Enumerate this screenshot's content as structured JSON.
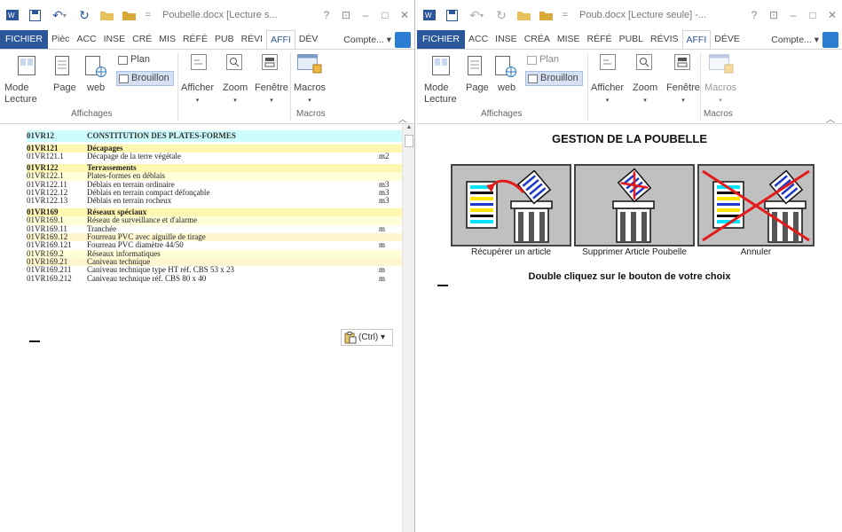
{
  "left_window": {
    "title": "Poubelle.docx [Lecture s...",
    "help": "?",
    "tabs": [
      "FICHIER",
      "Pièc",
      "ACC",
      "INSE",
      "CRÉ",
      "MIS",
      "RÉFÉ",
      "PUB",
      "RÉVI",
      "AFFI",
      "DÉV"
    ],
    "active_tab": "AFFI",
    "account": "Compte... ▾",
    "ribbon": {
      "mode_lecture": "Mode\nLecture",
      "mode_lecture_1": "Mode",
      "mode_lecture_2": "Lecture",
      "page": "Page",
      "web": "web",
      "plan": "Plan",
      "brouillon": "Brouillon",
      "afficher": "Afficher",
      "zoom": "Zoom",
      "fenetre": "Fenêtre",
      "macros": "Macros",
      "group_affichages": "Affichages",
      "group_macros": "Macros"
    },
    "document": {
      "rows": [
        {
          "style": "hdr",
          "code": "01VR12",
          "desc": "CONSTITUTION DES PLATES-FORMES",
          "unit": ""
        },
        {
          "style": "gap"
        },
        {
          "style": "hy",
          "code": "01VR121",
          "desc": "Décapages",
          "unit": ""
        },
        {
          "style": "",
          "code": "01VR121.1",
          "desc": "Décapage de la terre végétale",
          "unit": "m2"
        },
        {
          "style": "gap"
        },
        {
          "style": "hy",
          "code": "01VR122",
          "desc": "Terrassements",
          "unit": ""
        },
        {
          "style": "ly",
          "code": "01VR122.1",
          "desc": "Plates-formes en déblais",
          "unit": ""
        },
        {
          "style": "",
          "code": "01VR122.11",
          "desc": "Déblais en terrain ordinaire",
          "unit": "m3"
        },
        {
          "style": "",
          "code": "01VR122.12",
          "desc": "Déblais en terrain compact défonçable",
          "unit": "m3"
        },
        {
          "style": "",
          "code": "01VR122.13",
          "desc": "Déblais en terrain rocheux",
          "unit": "m3"
        },
        {
          "style": "gap"
        },
        {
          "style": "hy",
          "code": "01VR169",
          "desc": "Réseaux spéciaux",
          "unit": ""
        },
        {
          "style": "ly",
          "code": "01VR169.1",
          "desc": "Réseau de surveillance et d'alarme",
          "unit": ""
        },
        {
          "style": "",
          "code": "01VR169.11",
          "desc": "Tranchée",
          "unit": "m"
        },
        {
          "style": "ly2",
          "code": "01VR169.12",
          "desc": "Fourreau PVC avec aiguille de tirage",
          "unit": ""
        },
        {
          "style": "",
          "code": "01VR169.121",
          "desc": "Fourreau PVC diamètre 44/50",
          "unit": "m"
        },
        {
          "style": "ly",
          "code": "01VR169.2",
          "desc": "Réseaux informatiques",
          "unit": ""
        },
        {
          "style": "ly2",
          "code": "01VR169.21",
          "desc": "Caniveau technique",
          "unit": ""
        },
        {
          "style": "",
          "code": "01VR169.211",
          "desc": "Caniveau technique type HT réf. CBS 53 x 23",
          "unit": "m"
        },
        {
          "style": "",
          "code": "01VR169.212",
          "desc": "Caniveau technique réf. CBS 80 x 40",
          "unit": "m"
        }
      ],
      "paste_options": "(Ctrl) ▾"
    }
  },
  "right_window": {
    "title": "Poub.docx [Lecture seule] -...",
    "help": "?",
    "tabs": [
      "FICHIER",
      "ACC",
      "INSE",
      "CRÉA",
      "MISE",
      "RÉFÉ",
      "PUBL",
      "RÉVIS",
      "AFFI",
      "DÉVE"
    ],
    "active_tab": "AFFI",
    "account": "Compte... ▾",
    "ribbon": {
      "mode_lecture_1": "Mode",
      "mode_lecture_2": "Lecture",
      "page": "Page",
      "web": "web",
      "plan": "Plan",
      "brouillon": "Brouillon",
      "afficher": "Afficher",
      "zoom": "Zoom",
      "fenetre": "Fenêtre",
      "macros": "Macros",
      "group_affichages": "Affichages",
      "group_macros": "Macros"
    },
    "document": {
      "heading": "GESTION DE LA POUBELLE",
      "buttons": [
        "Récupérer un article",
        "Supprimer Article Poubelle",
        "Annuler"
      ],
      "instruction": "Double cliquez sur le bouton de votre choix"
    }
  },
  "colors": {
    "word_blue": "#2b579a",
    "header_cyan": "#ccfcfc",
    "heading_yellow": "#fff7b0"
  }
}
